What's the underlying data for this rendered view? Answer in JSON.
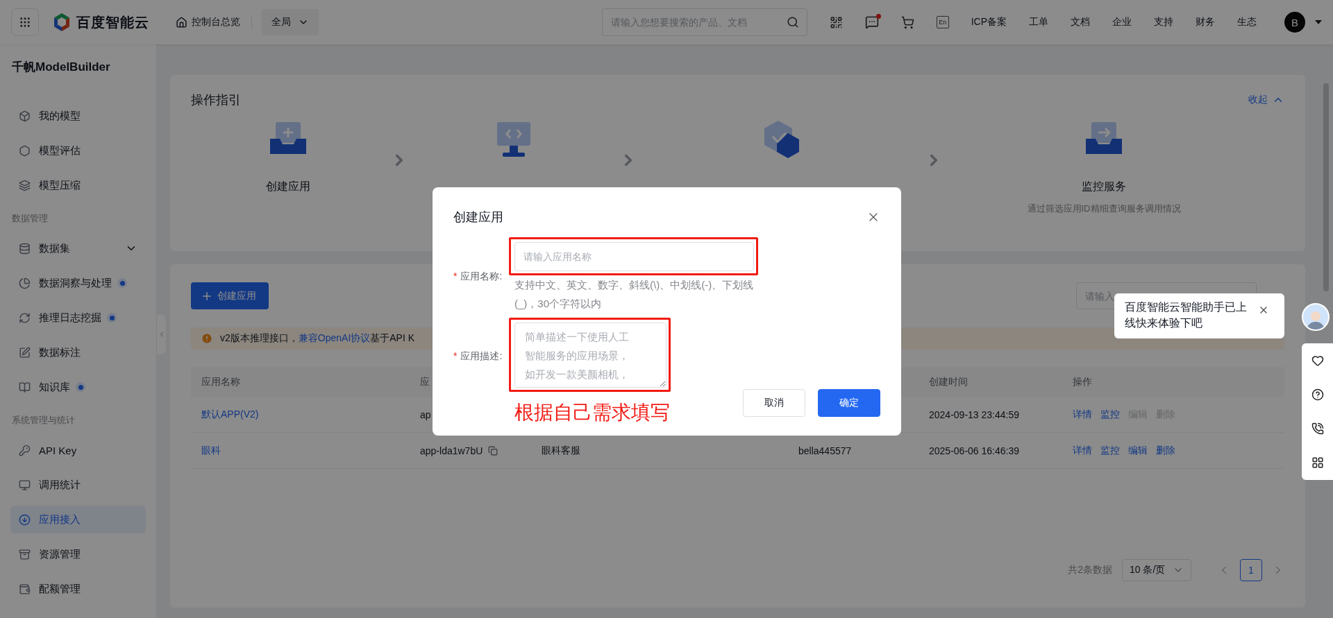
{
  "topbar": {
    "brand": "百度智能云",
    "home_link": "控制台总览",
    "region": "全局",
    "search_placeholder": "请输入您想要搜索的产品、文档",
    "messages_unread": true,
    "language": "En",
    "links": [
      "ICP备案",
      "工单",
      "文档",
      "企业",
      "支持",
      "财务",
      "生态"
    ],
    "avatar": "B"
  },
  "sidebar": {
    "title": "千帆ModelBuilder",
    "sections": [
      {
        "items": [
          {
            "label": "我的模型",
            "kind": "page",
            "selected": false,
            "dot": false
          },
          {
            "label": "模型评估",
            "kind": "page",
            "selected": false,
            "dot": false
          },
          {
            "label": "模型压缩",
            "kind": "page",
            "selected": false,
            "dot": false
          }
        ]
      },
      {
        "label": "数据管理",
        "items": [
          {
            "label": "数据集",
            "kind": "folder",
            "expanded": false,
            "selected": false,
            "dot": false
          },
          {
            "label": "数据洞察与处理",
            "kind": "page",
            "selected": false,
            "dot": true
          },
          {
            "label": "推理日志挖掘",
            "kind": "page",
            "selected": false,
            "dot": true
          },
          {
            "label": "数据标注",
            "kind": "page",
            "selected": false,
            "dot": false
          },
          {
            "label": "知识库",
            "kind": "page",
            "selected": false,
            "dot": true
          }
        ]
      },
      {
        "label": "系统管理与统计",
        "items": [
          {
            "label": "API Key",
            "kind": "page",
            "selected": false,
            "dot": false
          },
          {
            "label": "调用统计",
            "kind": "page",
            "selected": false,
            "dot": false
          },
          {
            "label": "应用接入",
            "kind": "page",
            "selected": true,
            "dot": false
          },
          {
            "label": "资源管理",
            "kind": "page",
            "selected": false,
            "dot": false
          },
          {
            "label": "配额管理",
            "kind": "page",
            "selected": false,
            "dot": false
          }
        ]
      }
    ]
  },
  "guide": {
    "title": "操作指引",
    "toggle": "收起",
    "expanded": true,
    "steps": [
      {
        "kind": "create",
        "title": "创建应用"
      },
      {
        "kind": "app_id"
      },
      {
        "kind": "inference"
      },
      {
        "kind": "monitor",
        "title": "监控服务",
        "description": "通过筛选应用ID精细查询服务调用情况"
      }
    ]
  },
  "apps": {
    "create_button": "创建应用",
    "search_placeholder": "请输入",
    "notice": {
      "text": "v2版本推理接口，",
      "link": "兼容OpenAI协议",
      "rest": "基于API K"
    },
    "columns": {
      "name": "应用名称",
      "app_id": "应",
      "created": "创建时间",
      "actions": "操作"
    },
    "rows": [
      {
        "name": "默认APP(V2)",
        "app_id": "ap",
        "created": "2024-09-13 23:44:59",
        "actions": [
          {
            "label": "详情",
            "disabled": false
          },
          {
            "label": "监控",
            "disabled": false
          },
          {
            "label": "编辑",
            "disabled": true
          },
          {
            "label": "删除",
            "disabled": true
          }
        ]
      },
      {
        "name": "眼科",
        "app_id": "app-lda1w7bU",
        "description": "眼科客服",
        "creator": "bella445577",
        "created": "2025-06-06 16:46:39",
        "actions": [
          {
            "label": "详情",
            "disabled": false
          },
          {
            "label": "监控",
            "disabled": false
          },
          {
            "label": "编辑",
            "disabled": false
          },
          {
            "label": "删除",
            "disabled": false
          }
        ]
      }
    ],
    "pagination": {
      "total": "共2条数据",
      "page_size": "10 条/页",
      "pages": [
        {
          "label": "1",
          "selected": true
        }
      ]
    }
  },
  "dialog": {
    "title": "创建应用",
    "fields": [
      {
        "kind": "input",
        "mark": "*",
        "label": "应用名称:",
        "placeholder": "请输入应用名称",
        "hint": "支持中文、英文、数字、斜线(\\)、中划线(-)、下划线(_)，30个字符以内",
        "highlighted": true
      },
      {
        "kind": "textarea",
        "mark": "*",
        "label": "应用描述:",
        "placeholder": "简单描述一下使用人工智能服务的应用场景，如开发一款美颜相机，",
        "highlighted": true
      }
    ],
    "annotation": "根据自己需求填写",
    "buttons": [
      {
        "label": "取消",
        "kind": "secondary"
      },
      {
        "label": "确定",
        "kind": "primary"
      }
    ]
  },
  "assistant": {
    "message": "百度智能云智能助手已上线快来体验下吧"
  }
}
